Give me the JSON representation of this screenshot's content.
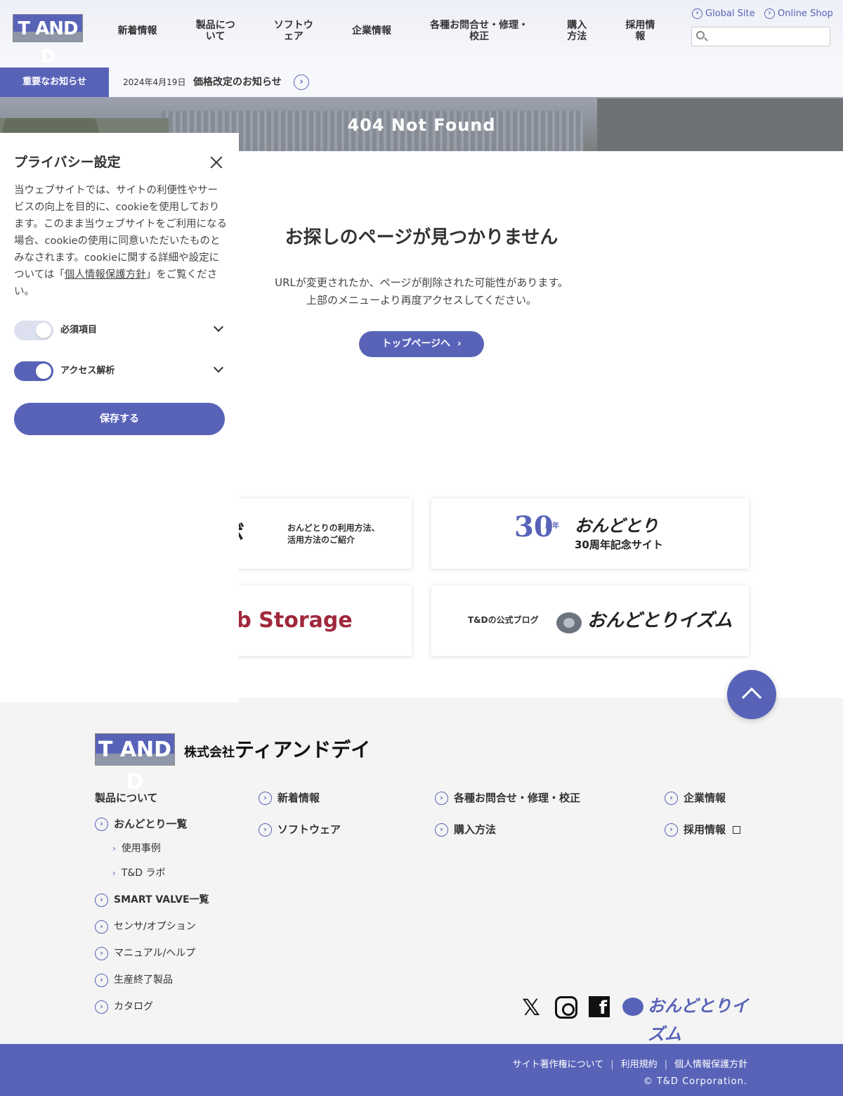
{
  "header": {
    "logo_text": "T AND D",
    "nav": [
      "新着情報",
      "製品につ\nいて",
      "ソフトウ\nェア",
      "企業情報",
      "各種お問合せ・修理・\n校正",
      "購入\n方法",
      "採用情\n報"
    ],
    "global_site": "Global Site",
    "online_shop": "Online Shop",
    "search_placeholder": ""
  },
  "notice": {
    "label": "重要なお知らせ",
    "date": "2024年4月19日",
    "title": "価格改定のお知らせ"
  },
  "hero": {
    "title": "404 Not Found"
  },
  "main": {
    "heading": "お探しのページが見つかりません",
    "description": "URLが変更されたか、ページが削除された可能性があります。\n上部のメニューより再度アクセスしてください。",
    "top_button": "トップページへ"
  },
  "banners": {
    "labo_title": "ラボ",
    "labo_desc": "おんどとりの利用方法、\n活用方法のご紹介",
    "anniv_number": "30",
    "anniv_sub": "周年",
    "anniv_title": "おんどとり",
    "anniv_subtitle": "30周年記念サイト",
    "webstorage": "Web Storage",
    "blog_label": "T&Dの公式ブログ",
    "blog_title": "おんどとりイズム"
  },
  "privacy": {
    "title": "プライバシー設定",
    "text_before": "当ウェブサイトでは、サイトの利便性やサービスの向上を目的に、cookieを使用しております。このまま当ウェブサイトをご利用になる場合、cookieの使用に同意いただいたものとみなされます。cookieに関する詳細や設定については「",
    "link": "個人情報保護方針",
    "text_after": "」をご覧ください。",
    "toggles": [
      {
        "label": "必須項目",
        "on": false
      },
      {
        "label": "アクセス解析",
        "on": true
      }
    ],
    "save_button": "保存する"
  },
  "footer": {
    "logo_text": "T AND D",
    "company_prefix": "株式会社",
    "company_name": "ティアンドデイ",
    "products_heading": "製品について",
    "products_links": [
      "おんどとり一覧",
      "SMART VALVE一覧",
      "センサ/オプション",
      "マニュアル/ヘルプ",
      "生産終了製品",
      "カタログ"
    ],
    "products_sub": [
      "使用事例",
      "T&D ラボ"
    ],
    "col2": [
      "新着情報",
      "ソフトウェア"
    ],
    "col3": [
      "各種お問合せ・修理・校正",
      "購入方法"
    ],
    "col4": [
      "企業情報",
      "採用情報"
    ],
    "social_blog": "おんどとりイズム",
    "bottom_links": [
      "サイト著作権について",
      "利用規約",
      "個人情報保護方針"
    ],
    "copyright": "© T&D Corporation."
  },
  "colors": {
    "brand": "#5863b8",
    "footer_bg": "#f4f4f4",
    "webstorage": "#a0283c"
  }
}
